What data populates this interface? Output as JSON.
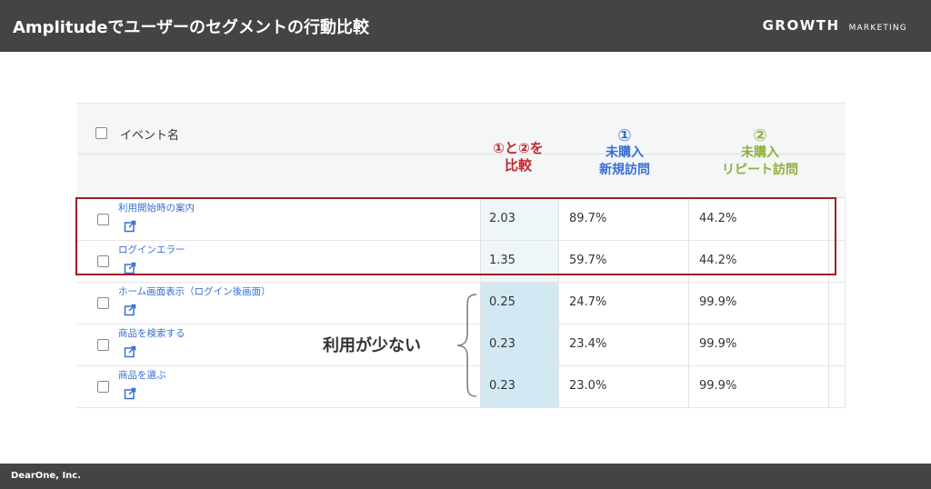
{
  "header": {
    "title": "Amplitudeでユーザーのセグメントの行動比較",
    "brand_main": "GROWTH",
    "brand_sub": "MARKETING"
  },
  "footer": {
    "company": "DearOne, Inc."
  },
  "table": {
    "event_header": "イベント名",
    "columns": {
      "compare": {
        "line1": "①と②を",
        "line2": "比較"
      },
      "new_visit": {
        "number": "①",
        "line1": "未購入",
        "line2": "新規訪問"
      },
      "repeat_visit": {
        "number": "②",
        "line1": "未購入",
        "line2": "リピート訪問"
      }
    },
    "rows": [
      {
        "name": "利用開始時の案内",
        "ratio": "2.03",
        "new": "89.7%",
        "repeat": "44.2%"
      },
      {
        "name": "ログインエラー",
        "ratio": "1.35",
        "new": "59.7%",
        "repeat": "44.2%"
      },
      {
        "name": "ホーム画面表示（ログイン後画面）",
        "ratio": "0.25",
        "new": "24.7%",
        "repeat": "99.9%"
      },
      {
        "name": "商品を検索する",
        "ratio": "0.23",
        "new": "23.4%",
        "repeat": "99.9%"
      },
      {
        "name": "商品を選ぶ",
        "ratio": "0.23",
        "new": "23.0%",
        "repeat": "99.9%"
      }
    ]
  },
  "annotation": {
    "low_usage": "利用が少ない"
  },
  "colors": {
    "bar": "#444444",
    "compare_red": "#c0272d",
    "blue": "#3a6fd6",
    "green": "#8db13a",
    "ratio_bg": "#d2e9f3",
    "highlight_border": "#a01d23"
  },
  "icons": {
    "external_link": "external-link-icon",
    "checkbox": "checkbox"
  }
}
